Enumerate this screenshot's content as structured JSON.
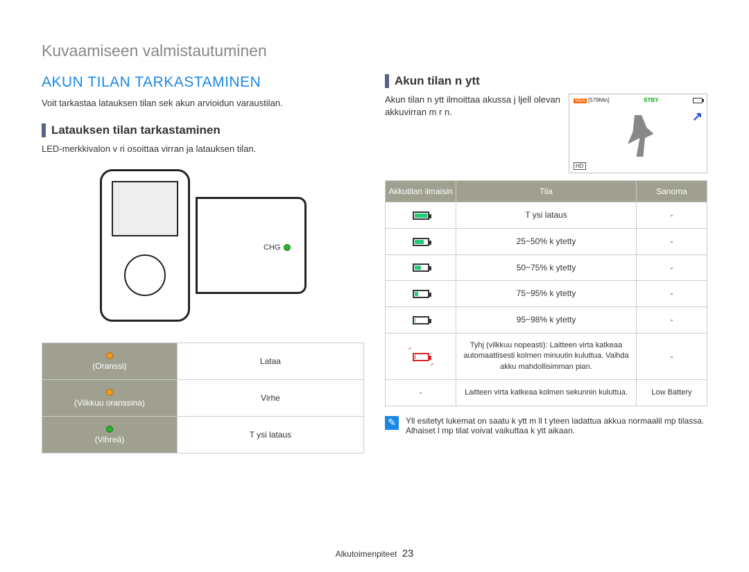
{
  "chapter_title": "Kuvaamiseen valmistautuminen",
  "section_title": "AKUN TILAN TARKASTAMINEN",
  "intro_left": "Voit tarkastaa latauksen tilan sek  akun arvioidun varaustilan.",
  "sub_left": "Latauksen tilan tarkastaminen",
  "body_left": "LED-merkkivalon v ri osoittaa virran ja latauksen tilan.",
  "chg_label": "CHG",
  "led_table": {
    "rows": [
      {
        "color": "(Oranssi)",
        "state": "Lataa"
      },
      {
        "color": "(Vilkkuu oranssina)",
        "state": "Virhe"
      },
      {
        "color": "(Vihreä)",
        "state": "T ysi lataus"
      }
    ]
  },
  "sub_right": "Akun tilan n ytt",
  "body_right": "Akun tilan n ytt  ilmoittaa akussa j ljell  olevan akkuvirran m  r n.",
  "display": {
    "vga": "VGA",
    "time": "[579Min]",
    "stby": "STBY",
    "hd": "HD"
  },
  "batt_table": {
    "headers": [
      "Akkutilan ilmaisin",
      "Tila",
      "Sanoma"
    ],
    "rows": [
      {
        "tila": "T ysi lataus",
        "sanoma": "-"
      },
      {
        "tila": "25~50% k ytetty",
        "sanoma": "-"
      },
      {
        "tila": "50~75% k ytetty",
        "sanoma": "-"
      },
      {
        "tila": "75~95% k ytetty",
        "sanoma": "-"
      },
      {
        "tila": "95~98% k ytetty",
        "sanoma": "-"
      },
      {
        "tila": "Tyhj  (vilkkuu nopeasti): Laitteen virta katkeaa automaattisesti kolmen minuutin kuluttua. Vaihda akku mahdollisimman pian.",
        "sanoma": "-"
      },
      {
        "icon": "-",
        "tila": "Laitteen virta katkeaa kolmen sekunnin kuluttua.",
        "sanoma": "Low Battery"
      }
    ]
  },
  "note_text": "Yll  esitetyt lukemat on saatu k ytt m ll  t yteen ladattua akkua normaalil mp tilassa. Alhaiset l mp tilat voivat vaikuttaa k ytt aikaan.",
  "footer_label": "Alkutoimenpiteet",
  "footer_page": "23"
}
